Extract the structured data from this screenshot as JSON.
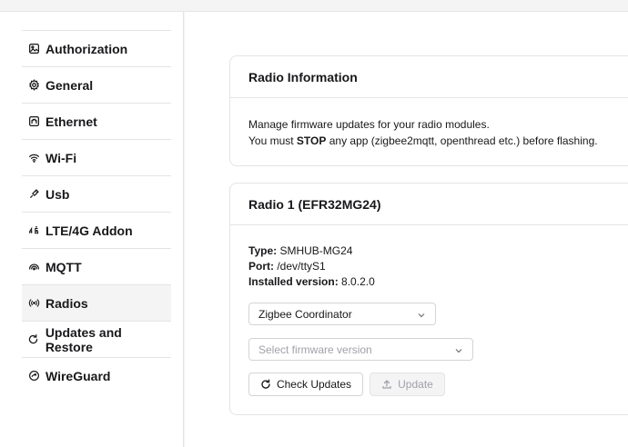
{
  "sidebar": {
    "items": [
      {
        "label": "Authorization",
        "icon": "image-icon"
      },
      {
        "label": "General",
        "icon": "gear-icon"
      },
      {
        "label": "Ethernet",
        "icon": "ethernet-icon"
      },
      {
        "label": "Wi-Fi",
        "icon": "wifi-icon"
      },
      {
        "label": "Usb",
        "icon": "usb-icon"
      },
      {
        "label": "LTE/4G Addon",
        "icon": "4g-icon"
      },
      {
        "label": "MQTT",
        "icon": "mqtt-icon"
      },
      {
        "label": "Radios",
        "icon": "radio-icon",
        "active": true
      },
      {
        "label": "Updates and Restore",
        "icon": "refresh-icon"
      },
      {
        "label": "WireGuard",
        "icon": "wireguard-icon"
      }
    ]
  },
  "radio_info": {
    "title": "Radio Information",
    "line1": "Manage firmware updates for your radio modules.",
    "line2_prefix": "You must ",
    "line2_bold": "STOP",
    "line2_suffix": " any app (zigbee2mqtt, openthread etc.) before flashing."
  },
  "radio1": {
    "title": "Radio 1 (EFR32MG24)",
    "type_label": "Type:",
    "type_value": "SMHUB-MG24",
    "port_label": "Port:",
    "port_value": "/dev/ttyS1",
    "version_label": "Installed version:",
    "version_value": "8.0.2.0",
    "role_select": "Zigbee Coordinator",
    "firmware_placeholder": "Select firmware version",
    "check_button": "Check Updates",
    "update_button": "Update"
  },
  "colors": {
    "active_bg": "#f4f4f5",
    "border": "#e4e4e7",
    "text": "#18181b",
    "muted": "#a1a1aa"
  }
}
